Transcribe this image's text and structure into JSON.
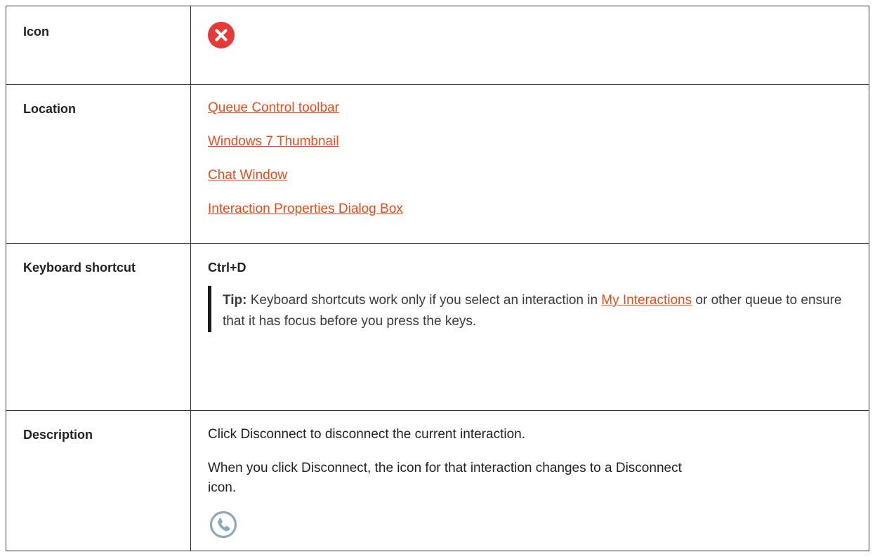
{
  "rows": {
    "icon": {
      "label": "Icon",
      "icon_name": "close-circle-icon",
      "icon_color": "#e53a38"
    },
    "location": {
      "label": "Location",
      "links": [
        "Queue Control toolbar",
        "Windows 7 Thumbnail",
        "Chat Window",
        "Interaction Properties Dialog Box"
      ],
      "link_color": "#ef4a1a"
    },
    "keyboard": {
      "label": "Keyboard shortcut",
      "shortcut": "Ctrl+D",
      "tip": {
        "label": "Tip:",
        "text_before": " Keyboard shortcuts work only if you select an interaction in ",
        "link": "My Interactions",
        "text_after": " or other queue to ensure that it has focus before you press the keys."
      }
    },
    "description": {
      "label": "Description",
      "line1": "Click Disconnect to disconnect the current interaction.",
      "line2": "When you click Disconnect, the icon for that interaction changes to a Disconnect icon.",
      "icon_name": "phone-disconnected-icon"
    }
  }
}
